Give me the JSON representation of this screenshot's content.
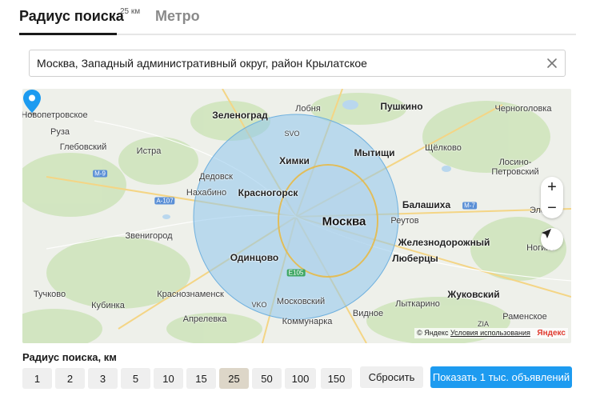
{
  "tabs": {
    "radius_label": "Радиус поиска",
    "radius_badge": "25 км",
    "metro_label": "Метро"
  },
  "address": {
    "value": "Москва, Западный административный округ, район Крылатское"
  },
  "map": {
    "labels": {
      "novopetrovskoe": "Новопетровское",
      "lobnya": "Лобня",
      "pushkino": "Пушкино",
      "chernogolovka": "Черноголовка",
      "zelenograd": "Зеленоград",
      "svo": "SVO",
      "ruza": "Руза",
      "glebovsky": "Глебовский",
      "istra": "Истра",
      "khimki": "Химки",
      "mytishchi": "Мытищи",
      "shchyolkovo": "Щёлково",
      "losino": "Лосино-\nПетровский",
      "dedovsk": "Дедовск",
      "nakhabino": "Нахабино",
      "krasnogorsk": "Красногорск",
      "balashikha": "Балашиха",
      "elek": "Эле",
      "moskva": "Москва",
      "reutov": "Реутов",
      "zvenigorod": "Звенигород",
      "zheleznodorozhny": "Железнодорожный",
      "noginsk_partial": "Ногинс",
      "odintsovo": "Одинцово",
      "lyubertsy": "Люберцы",
      "tuchkovo": "Тучково",
      "krasnoznamensk": "Краснознаменск",
      "vko": "VKO",
      "moskovsky": "Московский",
      "zhukovsky": "Жуковский",
      "kubinka": "Кубинка",
      "aprelevka": "Апрелевка",
      "kommunarka": "Коммунарка",
      "lytkarino": "Лыткарино",
      "ramenskoe": "Раменское",
      "vidnoe": "Видное",
      "zia": "ZIA",
      "m9": "М-9",
      "a107": "А-107",
      "m7": "М-7",
      "e105": "E105"
    },
    "zoom_in": "+",
    "zoom_out": "−",
    "copyright": "© Яндекс",
    "terms": "Условия использования",
    "brand": "Яндекс",
    "circle_color": "#8fc6ec",
    "pin_color": "#1d9bf0"
  },
  "radius": {
    "title": "Радиус поиска, км",
    "options": [
      "1",
      "2",
      "3",
      "5",
      "10",
      "15",
      "25",
      "50",
      "100",
      "150"
    ],
    "selected": "25"
  },
  "actions": {
    "reset": "Сбросить",
    "show": "Показать 1 тыс. объявлений"
  }
}
